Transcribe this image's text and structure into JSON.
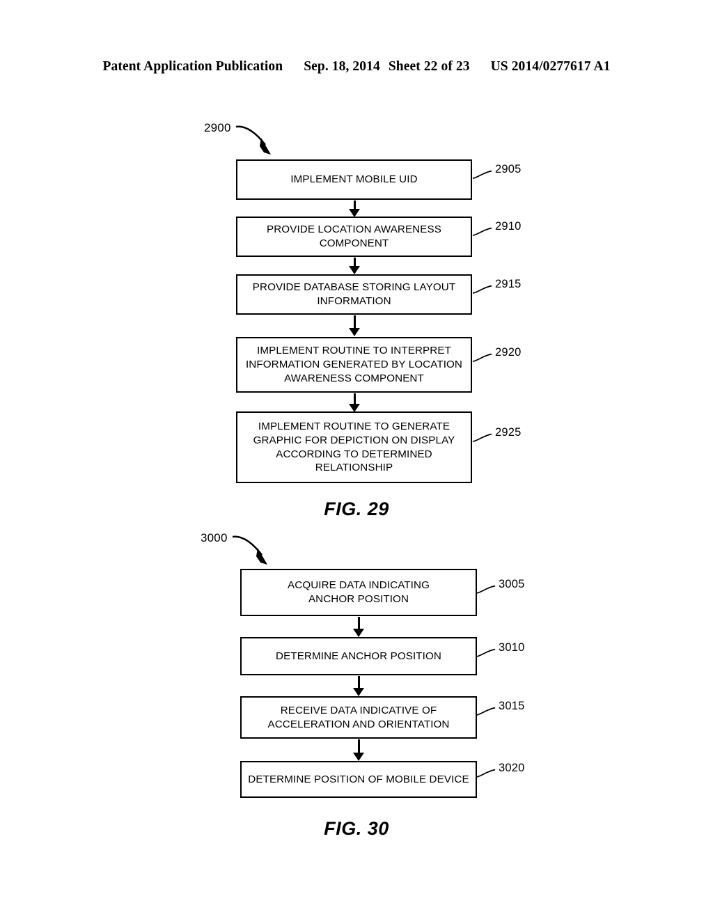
{
  "header": {
    "publication": "Patent Application Publication",
    "date": "Sep. 18, 2014",
    "sheet": "Sheet 22 of 23",
    "patent_number": "US 2014/0277617 A1"
  },
  "figures": [
    {
      "id": "2900",
      "caption": "FIG. 29",
      "steps": [
        {
          "ref": "2905",
          "lines": [
            "IMPLEMENT MOBILE UID"
          ]
        },
        {
          "ref": "2910",
          "lines": [
            "PROVIDE LOCATION AWARENESS",
            "COMPONENT"
          ]
        },
        {
          "ref": "2915",
          "lines": [
            "PROVIDE DATABASE STORING LAYOUT",
            "INFORMATION"
          ]
        },
        {
          "ref": "2920",
          "lines": [
            "IMPLEMENT ROUTINE TO INTERPRET",
            "INFORMATION GENERATED BY LOCATION",
            "AWARENESS COMPONENT"
          ]
        },
        {
          "ref": "2925",
          "lines": [
            "IMPLEMENT ROUTINE TO GENERATE",
            "GRAPHIC FOR DEPICTION ON DISPLAY",
            "ACCORDING TO DETERMINED",
            "RELATIONSHIP"
          ]
        }
      ]
    },
    {
      "id": "3000",
      "caption": "FIG. 30",
      "steps": [
        {
          "ref": "3005",
          "lines": [
            "ACQUIRE DATA INDICATING",
            "ANCHOR POSITION"
          ]
        },
        {
          "ref": "3010",
          "lines": [
            "DETERMINE ANCHOR POSITION"
          ]
        },
        {
          "ref": "3015",
          "lines": [
            "RECEIVE DATA INDICATIVE OF",
            "ACCELERATION AND ORIENTATION"
          ]
        },
        {
          "ref": "3020",
          "lines": [
            "DETERMINE POSITION OF MOBILE DEVICE"
          ]
        }
      ]
    }
  ],
  "colors": {
    "ink": "#000000",
    "paper": "#ffffff"
  }
}
